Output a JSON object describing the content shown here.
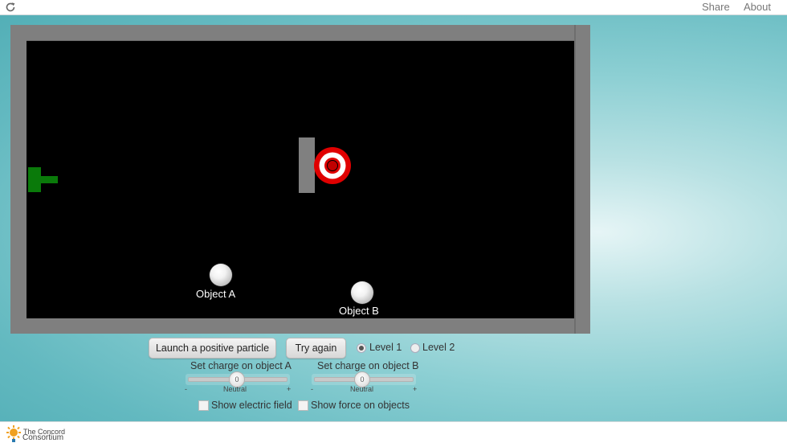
{
  "topbar": {
    "reload_icon": "reload-icon",
    "share_label": "Share",
    "about_label": "About"
  },
  "simulation": {
    "objects": [
      {
        "label": "Object A"
      },
      {
        "label": "Object B"
      }
    ],
    "colors": {
      "arena": "#000000",
      "frame": "#7f7f7f",
      "launcher": "#0a7a0a",
      "barrier": "#808080",
      "target_outer": "#e00000",
      "target_ring": "#ffffff"
    }
  },
  "controls": {
    "launch_button": "Launch a positive particle",
    "try_again_button": "Try again",
    "levels": [
      {
        "label": "Level 1",
        "checked": true
      },
      {
        "label": "Level 2",
        "checked": false
      }
    ],
    "slider_a": {
      "title": "Set charge on object A",
      "value": "0",
      "min_label": "-",
      "mid_label": "Neutral",
      "max_label": "+"
    },
    "slider_b": {
      "title": "Set charge on object B",
      "value": "0",
      "min_label": "-",
      "mid_label": "Neutral",
      "max_label": "+"
    },
    "show_field_label": "Show electric field",
    "show_force_label": "Show force on objects"
  },
  "footer": {
    "logo_line1": "The Concord",
    "logo_line2": "Consortium"
  }
}
